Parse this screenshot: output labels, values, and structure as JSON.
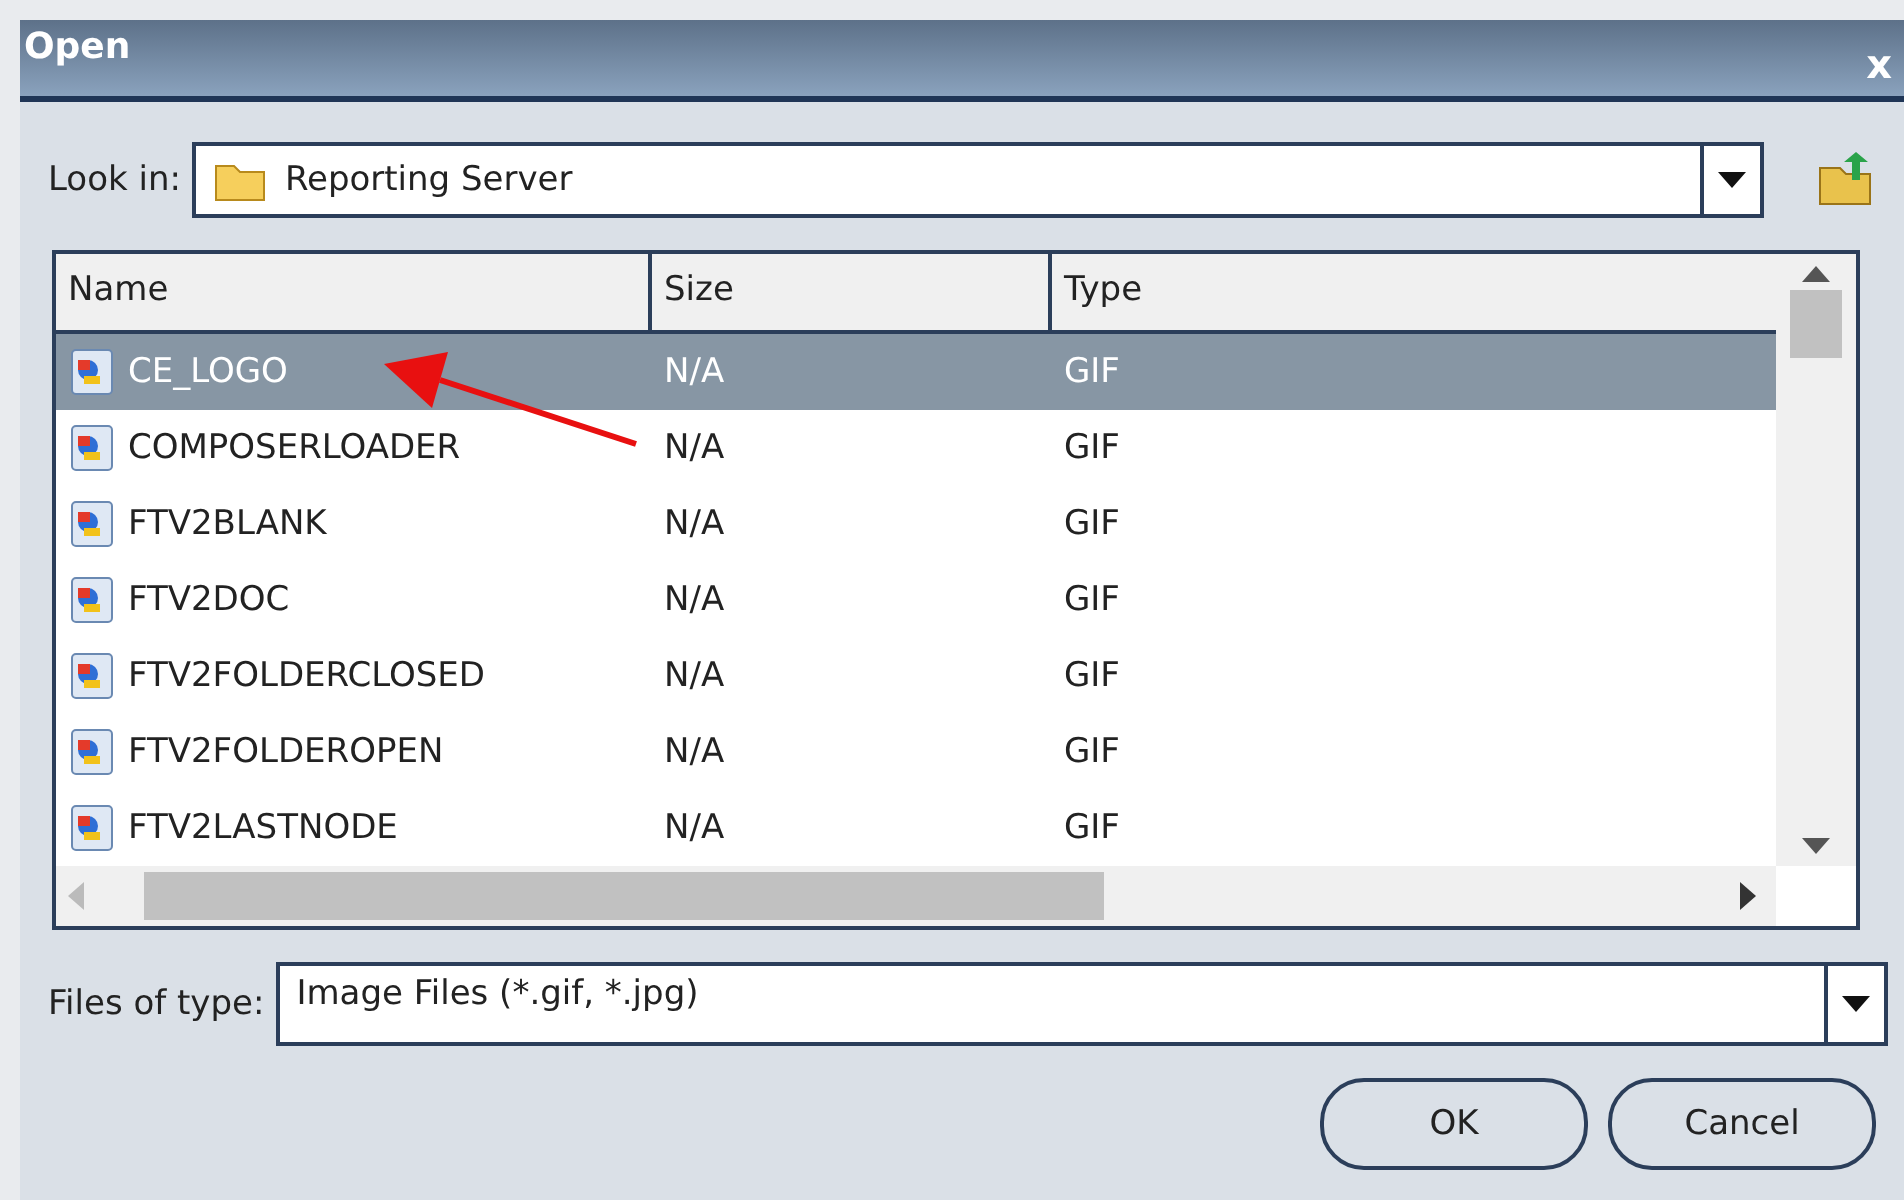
{
  "window": {
    "title": "Open",
    "close": "x"
  },
  "look_in": {
    "label": "Look in:",
    "value": "Reporting Server"
  },
  "table": {
    "columns": [
      "Name",
      "Size",
      "Type"
    ],
    "rows": [
      {
        "name": "CE_LOGO",
        "size": "N/A",
        "type": "GIF",
        "selected": true
      },
      {
        "name": "COMPOSERLOADER",
        "size": "N/A",
        "type": "GIF",
        "selected": false
      },
      {
        "name": "FTV2BLANK",
        "size": "N/A",
        "type": "GIF",
        "selected": false
      },
      {
        "name": "FTV2DOC",
        "size": "N/A",
        "type": "GIF",
        "selected": false
      },
      {
        "name": "FTV2FOLDERCLOSED",
        "size": "N/A",
        "type": "GIF",
        "selected": false
      },
      {
        "name": "FTV2FOLDEROPEN",
        "size": "N/A",
        "type": "GIF",
        "selected": false
      },
      {
        "name": "FTV2LASTNODE",
        "size": "N/A",
        "type": "GIF",
        "selected": false
      }
    ]
  },
  "files_of_type": {
    "label": "Files of type:",
    "value": "Image Files (*.gif, *.jpg)"
  },
  "buttons": [
    "OK",
    "Cancel"
  ]
}
